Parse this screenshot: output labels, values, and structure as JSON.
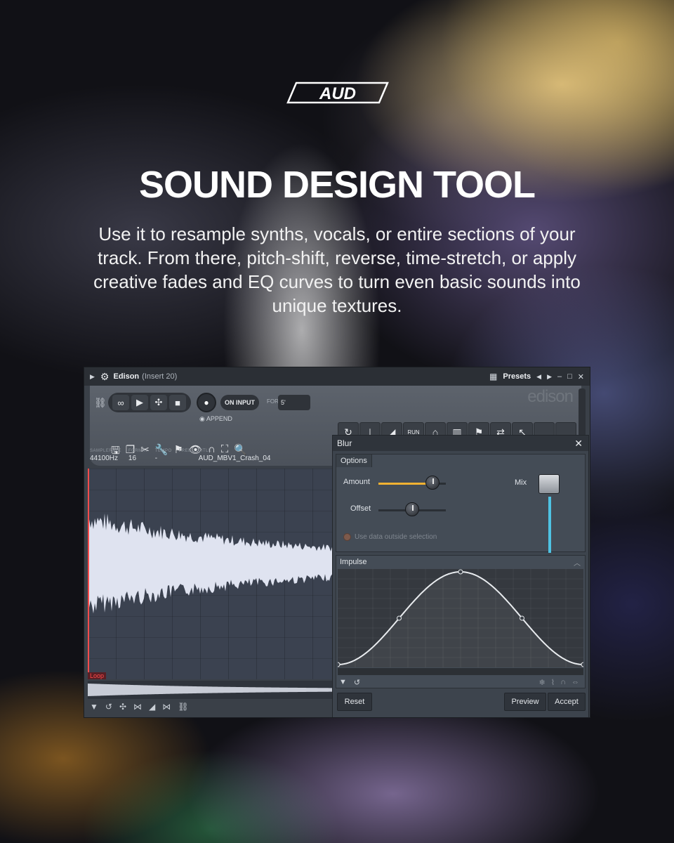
{
  "brand": {
    "logo_text": "AUD"
  },
  "headline": "SOUND DESIGN TOOL",
  "subtext": "Use it to resample synths, vocals, or entire sections of your track. From there, pitch-shift, reverse, time-stretch, or apply creative fades and EQ curves to turn even basic sounds into unique textures.",
  "edison": {
    "title": "Edison",
    "subtitle": "(Insert 20)",
    "presets_label": "Presets",
    "brand_text": "edison",
    "on_input_label": "ON INPUT",
    "for_label": "FOR",
    "for_value": "5'",
    "append_label": "APPEND",
    "info": {
      "samplerate_label": "SAMPLERATE",
      "samplerate_value": "44100Hz",
      "format_label": "FORMAT",
      "format_value": "16",
      "tempo_label": "TEMPO",
      "tempo_value": "-",
      "free_label": "FREE",
      "title_label": "TITLE",
      "title_value": "AUD_MBV1_Crash_04"
    },
    "loop_label": "Loop",
    "run_label": "RUN"
  },
  "blur": {
    "title": "Blur",
    "options_tab": "Options",
    "amount_label": "Amount",
    "amount_value": 0.8,
    "offset_label": "Offset",
    "offset_value": 0.5,
    "mix_label": "Mix",
    "mix_value": 1.0,
    "use_data_label": "Use data outside selection",
    "impulse_label": "Impulse",
    "reset_label": "Reset",
    "preview_label": "Preview",
    "accept_label": "Accept"
  },
  "colors": {
    "accent_amount": "#f0b132",
    "accent_mix": "#4fc3e3",
    "loop_marker": "#ff4b4b"
  }
}
